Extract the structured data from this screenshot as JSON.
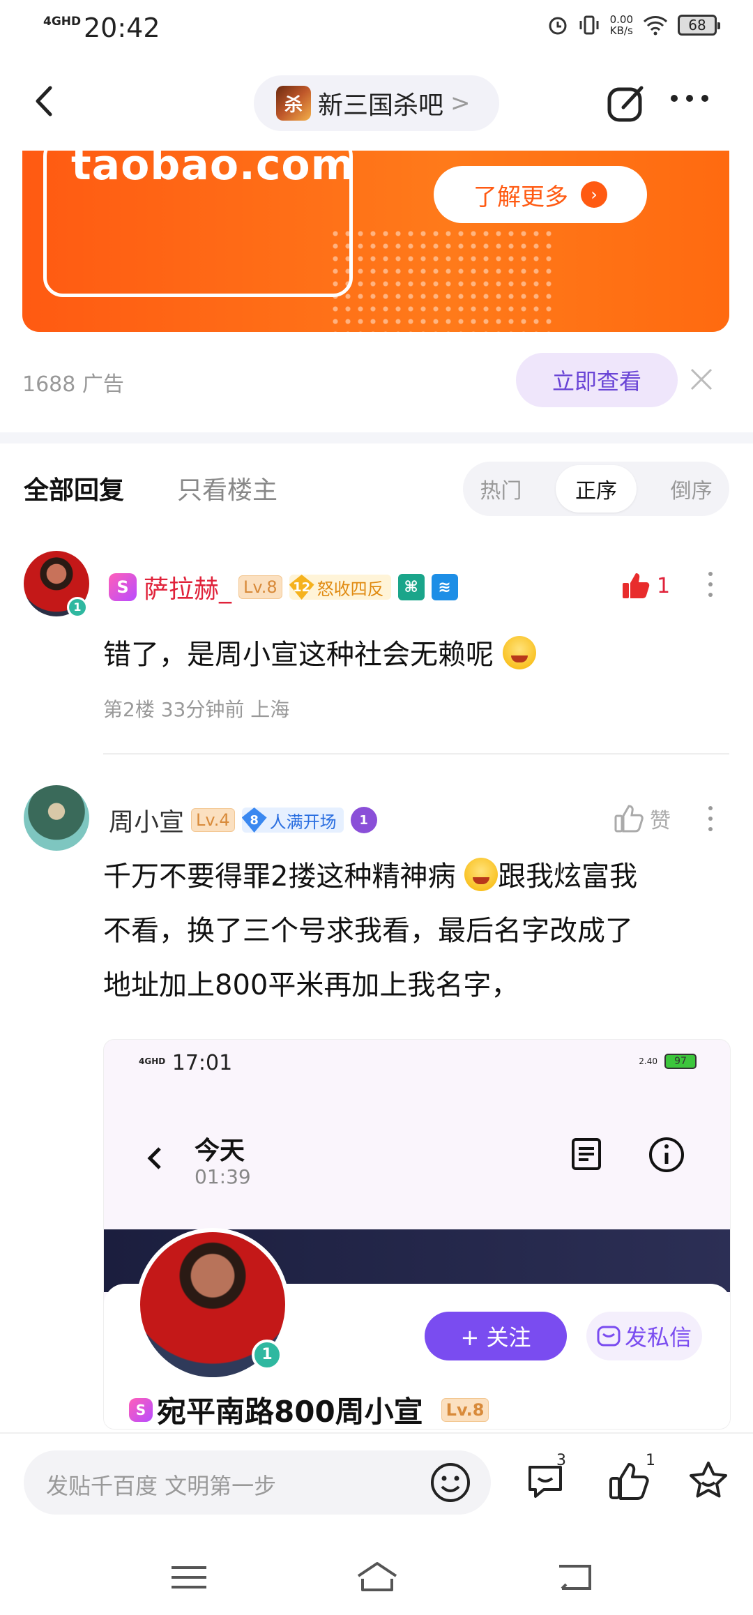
{
  "status": {
    "net": "4GHD",
    "time": "20:42",
    "speed_value": "0.00",
    "speed_unit": "KB/s",
    "battery": "68"
  },
  "header": {
    "forum_logo_text": "杀",
    "forum_name": "新三国杀吧",
    "chevron": ">"
  },
  "ad": {
    "brand_text": "taobao.com",
    "cta": "了解更多",
    "source": "1688 广告",
    "view_button": "立即查看",
    "brand_color": "#ff5a12"
  },
  "tabs": {
    "all_replies": "全部回复",
    "op_only": "只看楼主",
    "sort": [
      "热门",
      "正序",
      "倒序"
    ],
    "active_sort": "正序"
  },
  "comments": [
    {
      "username": "萨拉赫_",
      "level": "Lv.8",
      "honor_level": "12",
      "honor": "怒收四反",
      "avatar_badge": "1",
      "likes": "1",
      "text": "错了，是周小宣这种社会无赖呢",
      "meta": "第2楼  33分钟前  上海"
    },
    {
      "username": "周小宣",
      "level": "Lv.4",
      "honor_level": "8",
      "honor": "人满开场",
      "like_label": "赞",
      "text_line1": "千万不要得罪2搂这种精神病",
      "text_line1b": "跟我炫富我",
      "text_line2": "不看，换了三个号求我看，最后名字改成了",
      "text_line3": "地址加上800平米再加上我名字，"
    }
  ],
  "embedded": {
    "net": "4GHD",
    "time": "17:01",
    "speed": "2.40",
    "battery": "97",
    "title": "今天",
    "subtitle": "01:39",
    "follow": "+ 关注",
    "message": "发私信",
    "profile_name": "宛平南路800周小宣",
    "level": "Lv.8",
    "avatar_badge": "1"
  },
  "bottom": {
    "reply_placeholder": "发贴千百度 文明第一步",
    "comment_count": "3",
    "like_count": "1"
  }
}
